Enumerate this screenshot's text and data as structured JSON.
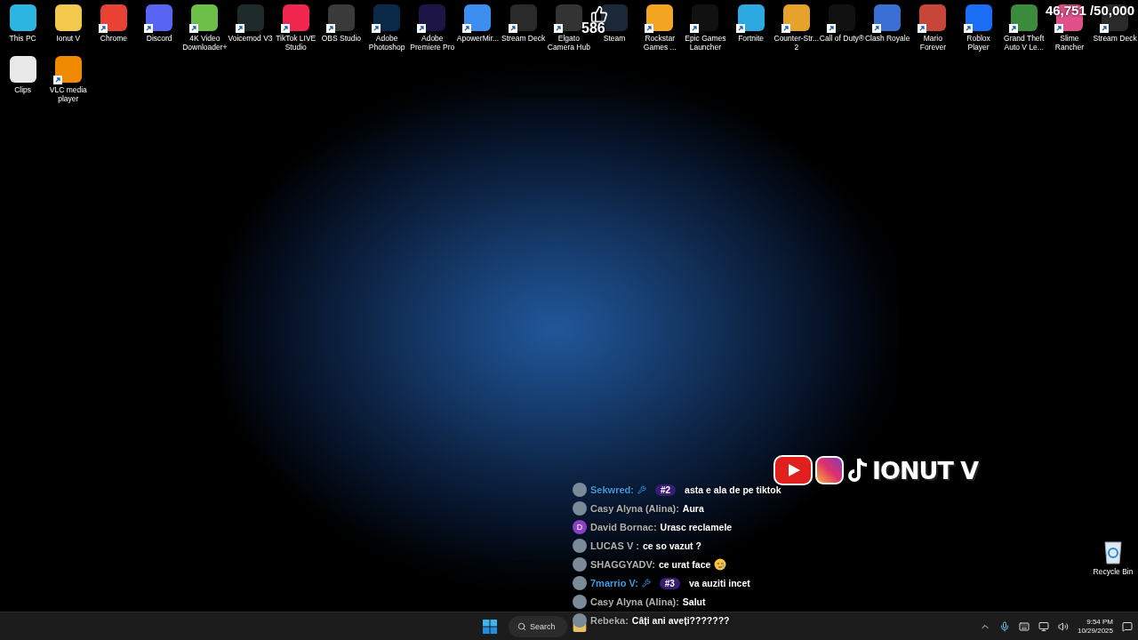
{
  "desktop_icons": [
    {
      "label": "This PC",
      "color": "#2bb5e0",
      "shortcut": false
    },
    {
      "label": "Ionut V",
      "color": "#f2c94c",
      "shortcut": false
    },
    {
      "label": "Chrome",
      "color": "#e94235",
      "shortcut": true
    },
    {
      "label": "Discord",
      "color": "#5865f2",
      "shortcut": true
    },
    {
      "label": "4K Video Downloader+",
      "color": "#6cc04a",
      "shortcut": true
    },
    {
      "label": "Voicemod V3",
      "color": "#1f2a2a",
      "shortcut": true
    },
    {
      "label": "TikTok LIVE Studio",
      "color": "#f0264f",
      "shortcut": true
    },
    {
      "label": "OBS Studio",
      "color": "#3a3a3a",
      "shortcut": true
    },
    {
      "label": "Adobe Photoshop",
      "color": "#0b2a4a",
      "shortcut": true
    },
    {
      "label": "Adobe Premiere Pro",
      "color": "#1d1545",
      "shortcut": true
    },
    {
      "label": "ApowerMir...",
      "color": "#3d8ef0",
      "shortcut": true
    },
    {
      "label": "Stream Deck",
      "color": "#2a2a2a",
      "shortcut": true
    },
    {
      "label": "Elgato Camera Hub",
      "color": "#333333",
      "shortcut": true
    },
    {
      "label": "Steam",
      "color": "#1b2838",
      "shortcut": false
    },
    {
      "label": "Rockstar Games ...",
      "color": "#f4a623",
      "shortcut": true
    },
    {
      "label": "Epic Games Launcher",
      "color": "#111111",
      "shortcut": true
    },
    {
      "label": "Fortnite",
      "color": "#2ea8e0",
      "shortcut": true
    },
    {
      "label": "Counter-Str... 2",
      "color": "#e7a22b",
      "shortcut": true
    },
    {
      "label": "Call of Duty®",
      "color": "#111111",
      "shortcut": true
    },
    {
      "label": "Clash Royale",
      "color": "#3b6fd6",
      "shortcut": true
    },
    {
      "label": "Mario Forever",
      "color": "#c8453a",
      "shortcut": true
    },
    {
      "label": "Roblox Player",
      "color": "#1a6ef5",
      "shortcut": true
    },
    {
      "label": "Grand Theft Auto V Le...",
      "color": "#3c8a3c",
      "shortcut": true
    },
    {
      "label": "Slime Rancher",
      "color": "#e2508a",
      "shortcut": true
    },
    {
      "label": "Stream Deck",
      "color": "#2a2a2a",
      "shortcut": true
    }
  ],
  "desktop_icons_row_2": [
    {
      "label": "Clips",
      "color": "#e8e8e8",
      "shortcut": false
    },
    {
      "label": "VLC media player",
      "color": "#f08a00",
      "shortcut": true
    }
  ],
  "recycle_bin": {
    "label": "Recycle Bin"
  },
  "stream_overlay": {
    "likes": "586",
    "goal": "46,751 /50,000",
    "channel_name": "IONUT V",
    "chat": [
      {
        "name": "Sekwred:",
        "color": "#3a9de6",
        "moderator": true,
        "badge": "#2",
        "message": "asta e ala de pe tiktok",
        "emoji": false
      },
      {
        "name": "Casy Alyna (Alina):",
        "color": "#b0b0b0",
        "moderator": false,
        "message": "Aura",
        "emoji": false
      },
      {
        "name": "David Bornac:",
        "color": "#b0b0b0",
        "moderator": false,
        "avatar_letter": "D",
        "message": "Urasc reclamele",
        "emoji": false
      },
      {
        "name": "LUCAS V :",
        "color": "#b0b0b0",
        "moderator": false,
        "message": "ce so vazut ?",
        "emoji": false
      },
      {
        "name": "SHAGGYADV:",
        "color": "#b0b0b0",
        "moderator": false,
        "message": "ce urat face",
        "emoji": true
      },
      {
        "name": "7marrio V:",
        "color": "#3a9de6",
        "moderator": true,
        "badge": "#3",
        "message": "va auziti incet",
        "emoji": false
      },
      {
        "name": "Casy Alyna (Alina):",
        "color": "#b0b0b0",
        "moderator": false,
        "message": "Salut",
        "emoji": false
      },
      {
        "name": "Rebeka:",
        "color": "#b0b0b0",
        "moderator": false,
        "message": "Câți ani aveți???????",
        "emoji": false
      }
    ]
  },
  "taskbar": {
    "search": {
      "placeholder": "Search"
    },
    "time": "9:54 PM",
    "date": "10/29/2025"
  }
}
